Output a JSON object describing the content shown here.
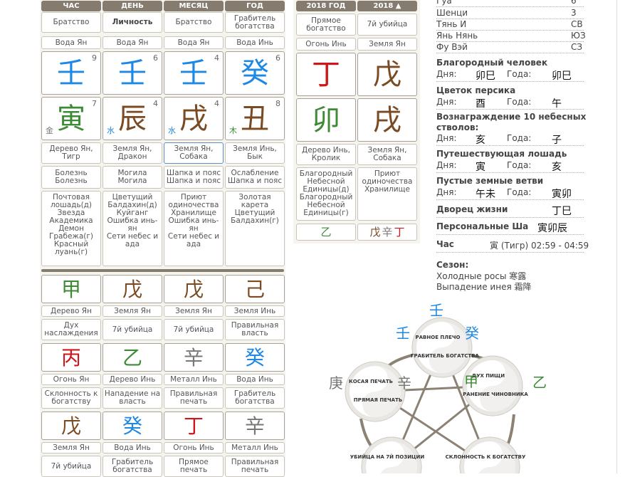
{
  "headers": {
    "left": [
      "ЧАС",
      "ДЕНЬ",
      "МЕСЯЦ",
      "ГОД"
    ],
    "mid": [
      "2018 ГОД",
      "2018 ▲"
    ]
  },
  "pillars": [
    {
      "role": "Братство",
      "stem_el": "Вода Ян",
      "stem": "壬",
      "stem_num": "9",
      "stem_color": "water",
      "branch": "寅",
      "branch_num": "7",
      "branch_el_char": "金",
      "branch_el_color": "metal",
      "branch_color": "wood",
      "animal": [
        "Дерево Ян,",
        "Тигр"
      ],
      "life": [
        "Болезнь",
        "Болезнь"
      ],
      "stars": [
        "Почтовая лошадь(д)",
        "Звезда Академика",
        "Демон Грабежа(г)",
        "Красный луань(г)"
      ]
    },
    {
      "role": "Личность",
      "stem_el": "Вода Ян",
      "stem": "壬",
      "stem_num": "6",
      "stem_color": "water",
      "branch": "辰",
      "branch_num": "4",
      "branch_el_char": "水",
      "branch_el_color": "water",
      "branch_color": "earth",
      "animal": [
        "Земля Ян,",
        "Дракон"
      ],
      "life": [
        "Могила",
        "Могила"
      ],
      "stars": [
        "Цветущий Балдахин(д)",
        "Куйганг",
        "Ошибка инь-ян",
        "Сети небес и ада"
      ]
    },
    {
      "role": "Братство",
      "stem_el": "Вода Ян",
      "stem": "壬",
      "stem_num": "4",
      "stem_color": "water",
      "branch": "戌",
      "branch_num": "4",
      "branch_el_char": "水",
      "branch_el_color": "water",
      "branch_color": "earth",
      "animal": [
        "Земля Ян,",
        "Собака"
      ],
      "life": [
        "Шапка и пояс",
        "Шапка и пояс"
      ],
      "stars": [
        "Приют одиночества",
        "Хранилище",
        "Ошибка инь-ян",
        "Сети небес и ада"
      ]
    },
    {
      "role": "Грабитель богатства",
      "stem_el": "Вода Инь",
      "stem": "癸",
      "stem_num": "6",
      "stem_color": "water",
      "branch": "丑",
      "branch_num": "8",
      "branch_el_char": "木",
      "branch_el_color": "wood",
      "branch_color": "earth",
      "animal": [
        "Земля Инь,",
        "Бык"
      ],
      "life": [
        "Ослабление",
        "Шапка и пояс"
      ],
      "stars": [
        "Золотая карета",
        "Цветущий Балдахин(г)"
      ]
    }
  ],
  "year_pillars": [
    {
      "role": "Прямое богатство",
      "stem_el": "Огонь Инь",
      "stem": "丁",
      "stem_color": "fire",
      "branch": "卯",
      "branch_color": "wood",
      "animal": [
        "Дерево Инь,",
        "Кролик"
      ],
      "stars": [
        "Благородный Небесной Единицы(д)",
        "Благородный Небесной Единицы(г)"
      ],
      "hidden": [
        {
          "ch": "乙",
          "color": "wood"
        }
      ]
    },
    {
      "role": "7й убийца",
      "stem_el": "Земля Ян",
      "stem": "戊",
      "stem_color": "earth",
      "branch": "戌",
      "branch_color": "earth",
      "animal": [
        "Земля Ян,",
        "Собака"
      ],
      "stars": [
        "Приют одиночества",
        "Хранилище"
      ],
      "hidden": [
        {
          "ch": "戊",
          "color": "earth"
        },
        {
          "ch": "辛",
          "color": "metal"
        },
        {
          "ch": "丁",
          "color": "fire"
        }
      ]
    }
  ],
  "lower_rows": [
    {
      "chars": [
        {
          "ch": "甲",
          "color": "wood"
        },
        {
          "ch": "戊",
          "color": "earth"
        },
        {
          "ch": "戊",
          "color": "earth"
        },
        {
          "ch": "己",
          "color": "earth"
        }
      ],
      "els": [
        "Дерево Ян",
        "Земля Ян",
        "Земля Ян",
        "Земля Инь"
      ],
      "roles": [
        [
          "Дух",
          "наслаждения"
        ],
        [
          "7й убийца"
        ],
        [
          "7й убийца"
        ],
        [
          "Правильная",
          "власть"
        ]
      ]
    },
    {
      "chars": [
        {
          "ch": "丙",
          "color": "fire"
        },
        {
          "ch": "乙",
          "color": "wood"
        },
        {
          "ch": "辛",
          "color": "metal"
        },
        {
          "ch": "癸",
          "color": "water"
        }
      ],
      "els": [
        "Огонь Ян",
        "Дерево Инь",
        "Металл Инь",
        "Вода Инь"
      ],
      "roles": [
        [
          "Склонность к",
          "богатству"
        ],
        [
          "Нападение на",
          "власть"
        ],
        [
          "Правильная",
          "печать"
        ],
        [
          "Грабитель",
          "богатства"
        ]
      ]
    },
    {
      "chars": [
        {
          "ch": "戊",
          "color": "earth"
        },
        {
          "ch": "癸",
          "color": "water"
        },
        {
          "ch": "丁",
          "color": "fire"
        },
        {
          "ch": "辛",
          "color": "metal"
        }
      ],
      "els": [
        "Земля Ян",
        "Вода Инь",
        "Огонь Инь",
        "Металл Инь"
      ],
      "roles": [
        [
          "7й убийца"
        ],
        [
          "Грабитель",
          "богатства"
        ],
        [
          "Прямое",
          "печать"
        ],
        [
          "Правильная",
          "печать"
        ]
      ]
    }
  ],
  "info_top": [
    {
      "label": "Гуа",
      "value": "6"
    },
    {
      "label": "Шенци",
      "value": "3"
    },
    {
      "label": "Тянь И",
      "value": "СВ"
    },
    {
      "label": "Янь Нянь",
      "value": "ЮЗ"
    },
    {
      "label": "Фу Вэй",
      "value": "СЗ"
    }
  ],
  "stars_info": [
    {
      "title": "Благородный человек",
      "day_label": "Дня:",
      "day": "卯巳",
      "year_label": "Года:",
      "year": "卯巳"
    },
    {
      "title": "Цветок персика",
      "day_label": "Дня:",
      "day": "酉",
      "year_label": "Года:",
      "year": "午"
    },
    {
      "title": "Вознаграждение 10 небесных",
      "title2": "стволов:",
      "day_label": "Дня:",
      "day": "亥",
      "year_label": "Года:",
      "year": "子"
    },
    {
      "title": "Путешествующая лошадь",
      "day_label": "Дня:",
      "day": "寅",
      "year_label": "Года:",
      "year": "亥"
    },
    {
      "title": "Пустые земные ветви",
      "day_label": "Дня:",
      "day": "午未",
      "year_label": "Года:",
      "year": "寅卯"
    }
  ],
  "life_palace": {
    "title": "Дворец жизни",
    "value": "丁巳"
  },
  "personal_sha": {
    "title": "Персональные Ша",
    "value": "寅卯辰"
  },
  "hour": {
    "title": "Час",
    "value": "寅 (Тигр) 02:59 - 04:59"
  },
  "season": {
    "title": "Сезон:",
    "lines": [
      "Холодные росы 寒露",
      "Выпадение инея 霜降"
    ]
  },
  "cycle": {
    "outer": [
      {
        "ch": "壬",
        "color": "water"
      },
      {
        "ch": "壬",
        "color": "water"
      },
      {
        "ch": "癸",
        "color": "water"
      },
      {
        "ch": "庚",
        "color": "metal"
      },
      {
        "ch": "辛",
        "color": "metal"
      },
      {
        "ch": "甲",
        "color": "wood"
      },
      {
        "ch": "乙",
        "color": "wood"
      }
    ],
    "nodes": [
      {
        "top": "РАВНОЕ ПЛЕЧО",
        "bottom": "ГРАБИТЕЛЬ БОГАТСТВА"
      },
      {
        "top": "ДУХ ПИЩИ",
        "bottom": "РАНЕНИЕ ЧИНОВНИКА"
      },
      {
        "top": "КОСАЯ ПЕЧАТЬ",
        "bottom": "ПРЯМАЯ ПЕЧАТЬ"
      },
      {
        "top": "УБИЙЦА НА 7Й ПОЗИЦИИ",
        "bottom": ""
      },
      {
        "top": "СКЛОННОСТЬ К БОГАТСТВУ",
        "bottom": ""
      }
    ]
  },
  "colors": {
    "water": "#1e88e5",
    "fire": "#d0161b",
    "wood": "#3d8b35",
    "earth": "#7a4a22",
    "metal": "#777777",
    "header": "#857b6e"
  }
}
